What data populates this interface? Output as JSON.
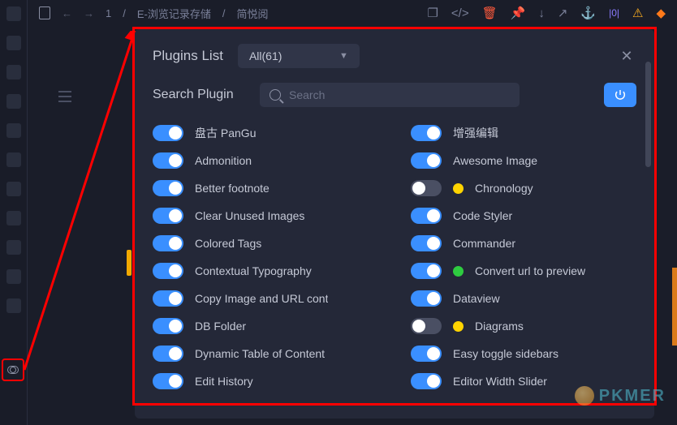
{
  "breadcrumb": {
    "arrow_number": "1",
    "path1": "E-浏览记录存储",
    "path2": "简悦阅"
  },
  "panel": {
    "title": "Plugins List",
    "filter_label": "All(61)",
    "search_label": "Search Plugin",
    "search_placeholder": "Search"
  },
  "plugins": {
    "left": [
      {
        "name": "盘古 PanGu",
        "on": true,
        "dot": null
      },
      {
        "name": "Admonition",
        "on": true,
        "dot": null
      },
      {
        "name": "Better footnote",
        "on": true,
        "dot": null
      },
      {
        "name": "Clear Unused Images",
        "on": true,
        "dot": null
      },
      {
        "name": "Colored Tags",
        "on": true,
        "dot": null
      },
      {
        "name": "Contextual Typography",
        "on": true,
        "dot": null
      },
      {
        "name": "Copy Image and URL cont",
        "on": true,
        "dot": null
      },
      {
        "name": "DB Folder",
        "on": true,
        "dot": null
      },
      {
        "name": "Dynamic Table of Content",
        "on": true,
        "dot": null
      },
      {
        "name": "Edit History",
        "on": true,
        "dot": null
      }
    ],
    "right": [
      {
        "name": "增强编辑",
        "on": true,
        "dot": null
      },
      {
        "name": "Awesome Image",
        "on": true,
        "dot": null
      },
      {
        "name": "Chronology",
        "on": false,
        "dot": "yellow"
      },
      {
        "name": "Code Styler",
        "on": true,
        "dot": null
      },
      {
        "name": "Commander",
        "on": true,
        "dot": null
      },
      {
        "name": "Convert url to preview",
        "on": true,
        "dot": "green"
      },
      {
        "name": "Dataview",
        "on": true,
        "dot": null
      },
      {
        "name": "Diagrams",
        "on": false,
        "dot": "yellow"
      },
      {
        "name": "Easy toggle sidebars",
        "on": true,
        "dot": null
      },
      {
        "name": "Editor Width Slider",
        "on": true,
        "dot": null
      }
    ]
  },
  "watermark": "PKMER"
}
